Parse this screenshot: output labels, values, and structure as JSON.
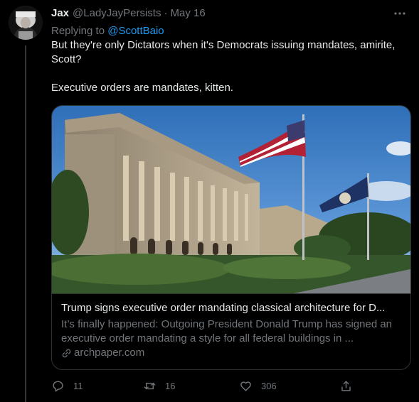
{
  "tweet": {
    "display_name": "Jax",
    "handle": "@LadyJayPersists",
    "separator": "·",
    "date": "May 16",
    "more_icon": "more-dots-icon",
    "replying_prefix": "Replying to ",
    "replying_to": "@ScottBaio",
    "text": "But they're only Dictators when it's Democrats issuing mandates, amirite, Scott?\n\nExecutive orders are mandates, kitten."
  },
  "card": {
    "title": "Trump signs executive order mandating classical architecture for D...",
    "description": "It’s finally happened: Outgoing President Donald Trump has signed an executive order mandating a style for all federal buildings in ...",
    "domain": "archpaper.com",
    "image_icon": "building-with-flags-image",
    "domain_icon": "link-icon"
  },
  "actions": {
    "reply_count": "11",
    "retweet_count": "16",
    "like_count": "306",
    "reply_icon": "reply-icon",
    "retweet_icon": "retweet-icon",
    "like_icon": "heart-icon",
    "share_icon": "share-icon"
  },
  "colors": {
    "background": "#000000",
    "primary_text": "#e7e9ea",
    "secondary_text": "#71767b",
    "accent": "#1d9bf0",
    "border": "#2f3336"
  }
}
